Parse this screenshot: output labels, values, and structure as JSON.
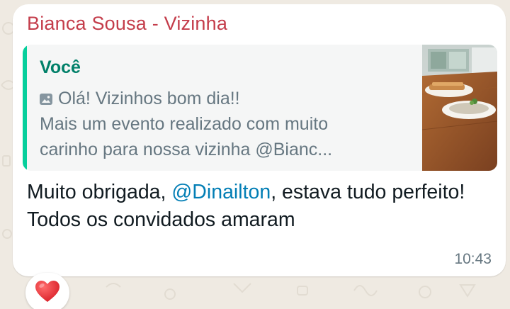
{
  "message": {
    "sender": "Bianca Sousa - Vizinha",
    "quoted": {
      "author": "Você",
      "media_icon": "photo-icon",
      "lines": [
        "Olá! Vizinhos bom dia!!",
        "Mais um evento realizado com muito",
        "carinho para nossa vizinha @Bianc..."
      ]
    },
    "text_before": "Muito obrigada, ",
    "mention": "@Dinailton",
    "text_after": ", estava tudo perfeito! Todos os convidados amaram",
    "time": "10:43"
  },
  "reaction": {
    "emoji": "heart-icon"
  },
  "colors": {
    "sender": "#c43d4b",
    "quote_author": "#008069",
    "quote_bar": "#06cf9c",
    "mention": "#027eb5",
    "background": "#efeae2",
    "reaction": "#e0202a"
  }
}
